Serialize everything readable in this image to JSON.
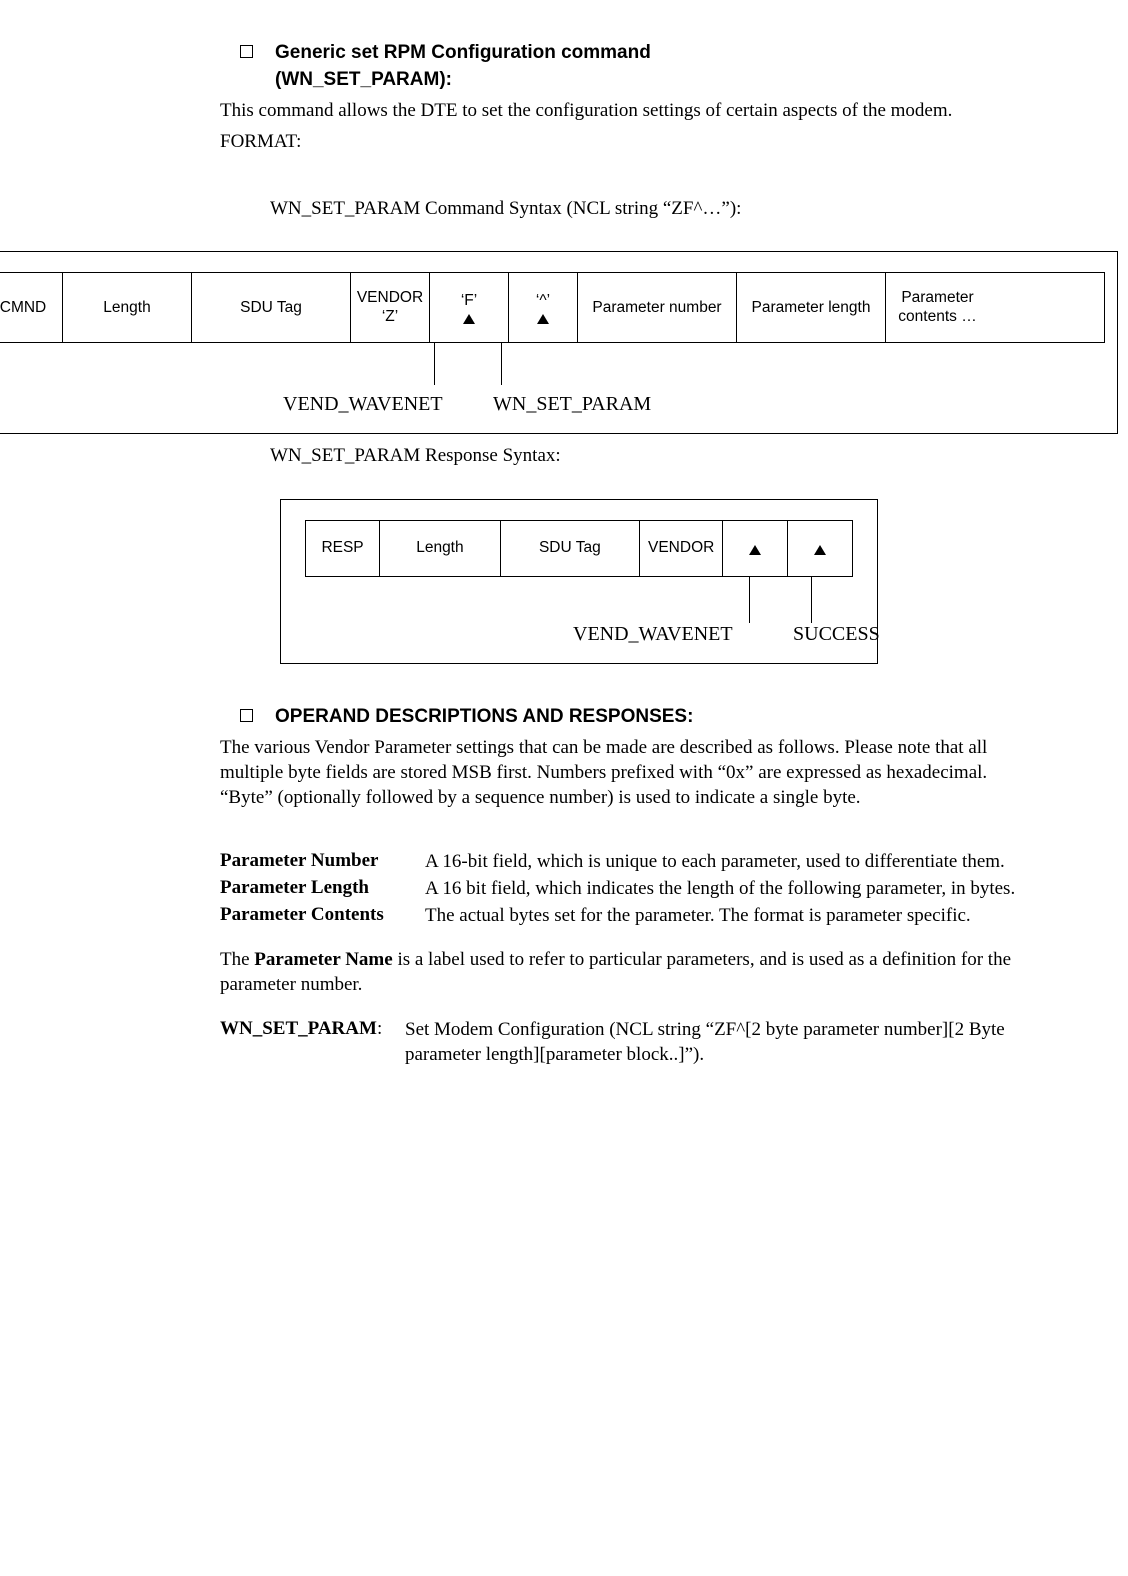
{
  "section1": {
    "heading_line1": "Generic set RPM Configuration command",
    "heading_line2": "(WN_SET_PARAM):",
    "intro": "This command allows the DTE to set the configuration settings of certain aspects of the modem.",
    "format_label": "FORMAT:",
    "cmd_syntax_title": "WN_SET_PARAM Command Syntax (NCL string “ZF^…”):"
  },
  "cmd_fields": {
    "c0": "CMND",
    "c1": "Length",
    "c2": "SDU Tag",
    "c3a": "VENDOR",
    "c3b": "‘Z’",
    "c4": "‘F’",
    "c5": "‘^’",
    "c6": "Parameter number",
    "c7": "Parameter length",
    "c8a": "Parameter",
    "c8b": "contents …"
  },
  "cmd_labels": {
    "l1": "VEND_WAVENET",
    "l2": "WN_SET_PARAM"
  },
  "resp_syntax_title": "WN_SET_PARAM Response Syntax:",
  "resp_fields": {
    "r0": "RESP",
    "r1": "Length",
    "r2": "SDU Tag",
    "r3": "VENDOR",
    "r4": "",
    "r5": ""
  },
  "resp_labels": {
    "l1": "VEND_WAVENET",
    "l2": "SUCCESS"
  },
  "section2": {
    "heading": "OPERAND DESCRIPTIONS AND RESPONSES:",
    "intro": "The various Vendor Parameter settings that can be made are described as follows.  Please note that all multiple byte fields are stored MSB first.  Numbers prefixed with “0x” are expressed as hexadecimal. “Byte” (optionally followed by a sequence number) is used to indicate a single byte."
  },
  "defs": [
    {
      "term": "Parameter Number",
      "desc": "A 16-bit field, which is unique to each parameter, used to differentiate them."
    },
    {
      "term": "Parameter Length",
      "desc": "A 16 bit field, which indicates the length of the following parameter, in bytes."
    },
    {
      "term": "Parameter Contents",
      "desc": "The actual bytes set for the parameter. The format is parameter specific."
    }
  ],
  "param_name_para_pre": "The ",
  "param_name_bold": "Parameter Name",
  "param_name_para_post": " is a label used to refer to particular parameters, and is used as a definition for the parameter number.",
  "wn_set_param": {
    "term": "WN_SET_PARAM",
    "colon": ":",
    "desc": "Set Modem Configuration  (NCL string “ZF^[2 byte parameter number][2 Byte parameter length][parameter block..]”)."
  }
}
